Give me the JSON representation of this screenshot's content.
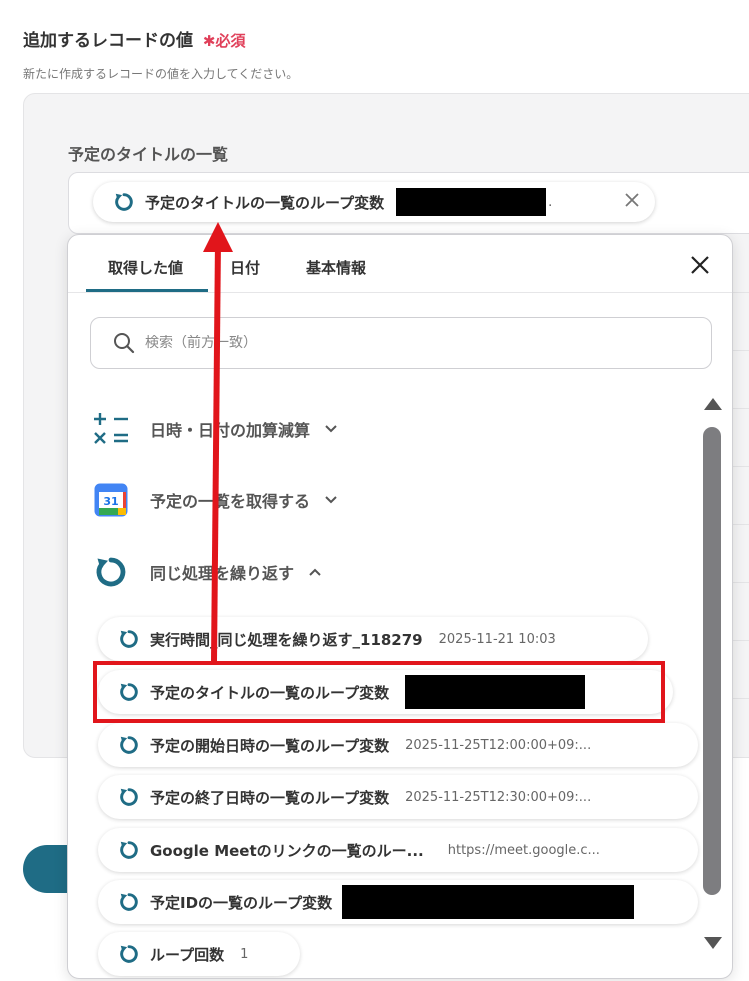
{
  "section": {
    "title": "追加するレコードの値",
    "required_mark": "✱",
    "required_label": "必須",
    "description": "新たに作成するレコードの値を入力してください。"
  },
  "field": {
    "label": "予定のタイトルの一覧",
    "chip_label": "予定のタイトルの一覧のループ変数",
    "chip_suffix": "."
  },
  "popup": {
    "tabs": [
      {
        "label": "取得した値",
        "active": true
      },
      {
        "label": "日付",
        "active": false
      },
      {
        "label": "基本情報",
        "active": false
      }
    ],
    "search_placeholder": "検索（前方一致）",
    "groups": [
      {
        "label": "日時・日付の加算減算",
        "icon": "calculator-icon",
        "expanded": false
      },
      {
        "label": "予定の一覧を取得する",
        "icon": "google-calendar-icon",
        "calendar_day": "31",
        "expanded": false
      },
      {
        "label": "同じ処理を繰り返す",
        "icon": "loop-icon",
        "expanded": true
      }
    ],
    "items": [
      {
        "label": "実行時間_同じ処理を繰り返す_118279",
        "value": "2025-11-21 10:03"
      },
      {
        "label": "予定のタイトルの一覧のループ変数",
        "value": ""
      },
      {
        "label": "予定の開始日時の一覧のループ変数",
        "value": "2025-11-25T12:00:00+09:..."
      },
      {
        "label": "予定の終了日時の一覧のループ変数",
        "value": "2025-11-25T12:30:00+09:..."
      },
      {
        "label": "Google Meetのリンクの一覧のルー...",
        "value": "https://meet.google.c..."
      },
      {
        "label": "予定IDの一覧のループ変数",
        "value": ""
      },
      {
        "label": "ループ回数",
        "value": "1"
      }
    ]
  },
  "colors": {
    "accent": "#1f6c85",
    "required": "#e0405a",
    "annotation": "#e1151b"
  }
}
